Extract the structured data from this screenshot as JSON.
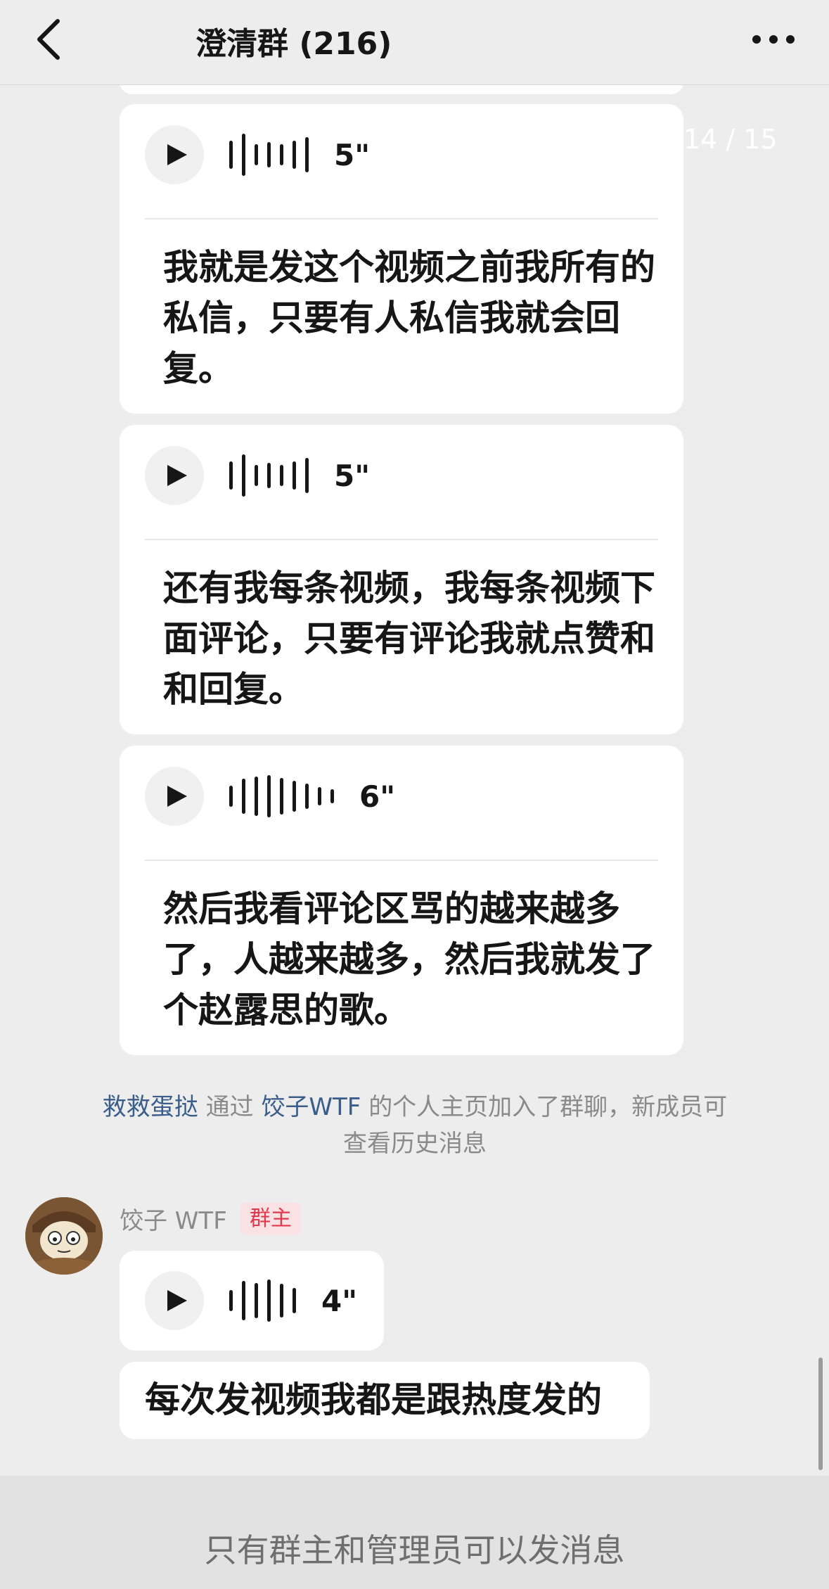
{
  "header": {
    "title": "澄清群 (216)",
    "back_icon": "chevron-left-icon",
    "more_icon": "more-dots-icon"
  },
  "page_indicator": "14 / 15",
  "messages": [
    {
      "type": "voice",
      "duration": "5\"",
      "transcript": "我就是发这个视频之前我所有的私信，只要有人私信我就会回复。"
    },
    {
      "type": "voice",
      "duration": "5\"",
      "transcript": "还有我每条视频，我每条视频下面评论，只要有评论我就点赞和和回复。"
    },
    {
      "type": "voice",
      "duration": "6\"",
      "transcript": "然后我看评论区骂的越来越多了，人越来越多，然后我就发了个赵露思的歌。"
    }
  ],
  "system_message": {
    "user": "救救蛋挞",
    "via_text": "通过",
    "inviter": "饺子WTF",
    "rest": "的个人主页加入了群聊，新成员可查看历史消息"
  },
  "sender": {
    "name": "饺子 WTF",
    "badge": "群主"
  },
  "last_voice": {
    "duration": "4\"",
    "transcript": "每次发视频我都是跟热度发的"
  },
  "footer": {
    "notice": "只有群主和管理员可以发消息"
  },
  "colors": {
    "background": "#ededed",
    "bubble": "#ffffff",
    "link": "#3a5d8c",
    "badge_text": "#e03a4e",
    "badge_bg": "#f9e1e4"
  }
}
